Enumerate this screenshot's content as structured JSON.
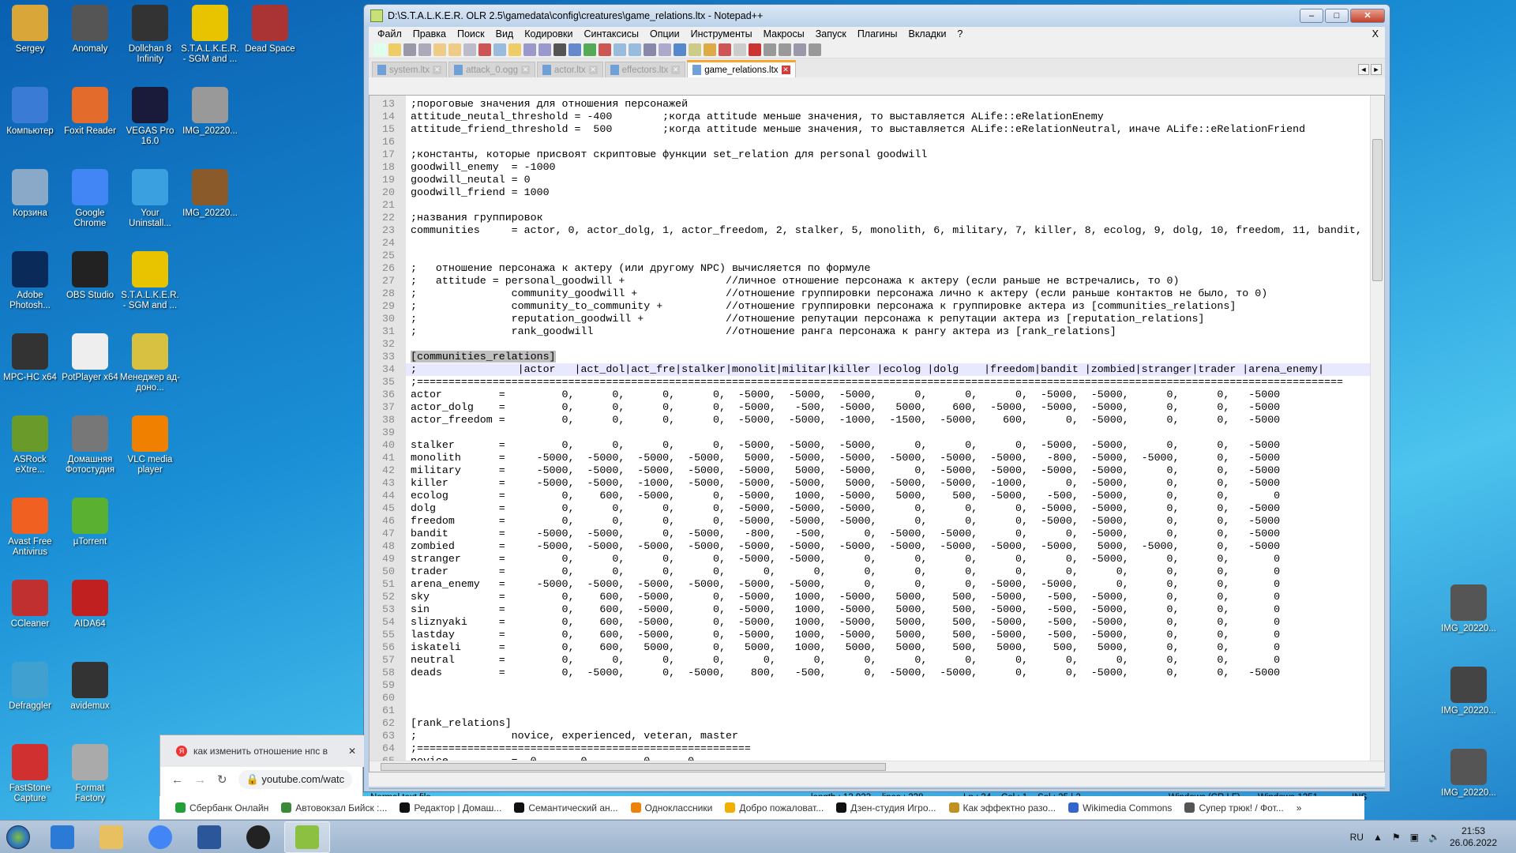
{
  "desktop": {
    "icons": [
      {
        "label": "Sergey",
        "color": "#d9a63a"
      },
      {
        "label": "Anomaly",
        "color": "#555"
      },
      {
        "label": "Dollchan 8 Infinity",
        "color": "#333"
      },
      {
        "label": "S.T.A.L.K.E.R. - SGM and ...",
        "color": "#e8c400"
      },
      {
        "label": "Dead Space",
        "color": "#a33"
      },
      {
        "label": "Компьютер",
        "color": "#3a7bd5"
      },
      {
        "label": "Foxit Reader",
        "color": "#e36b2c"
      },
      {
        "label": "VEGAS Pro 16.0",
        "color": "#1a1a3a"
      },
      {
        "label": "IMG_20220...",
        "color": "#999"
      },
      {
        "label": "Корзина",
        "color": "#8aa8c8"
      },
      {
        "label": "Google Chrome",
        "color": "#4285f4"
      },
      {
        "label": "Your Uninstall...",
        "color": "#3aa0e0"
      },
      {
        "label": "IMG_20220...",
        "color": "#8a5a2a"
      },
      {
        "label": "Adobe Photosh...",
        "color": "#0a2a5a"
      },
      {
        "label": "OBS Studio",
        "color": "#222"
      },
      {
        "label": "S.T.A.L.K.E.R. - SGM and ...",
        "color": "#e8c400"
      },
      {
        "label": "MPC-HC x64",
        "color": "#333"
      },
      {
        "label": "PotPlayer x64",
        "color": "#eee"
      },
      {
        "label": "Менеджер ад-доно...",
        "color": "#d8c040"
      },
      {
        "label": "ASRock eXtre...",
        "color": "#6a9a2a"
      },
      {
        "label": "Домашняя Фотостудия",
        "color": "#777"
      },
      {
        "label": "VLC media player",
        "color": "#f08000"
      },
      {
        "label": "Avast Free Antivirus",
        "color": "#f06020"
      },
      {
        "label": "µTorrent",
        "color": "#5ab030"
      },
      {
        "label": "CCleaner",
        "color": "#c03030"
      },
      {
        "label": "AIDA64",
        "color": "#c02020"
      },
      {
        "label": "Defraggler",
        "color": "#40a0d0"
      },
      {
        "label": "avidemux",
        "color": "#333"
      },
      {
        "label": "FastStone Capture",
        "color": "#d03030"
      },
      {
        "label": "Format Factory",
        "color": "#aaa"
      }
    ],
    "right_icons": [
      {
        "label": "IMG_20220...",
        "color": "#555"
      },
      {
        "label": "IMG_20220...",
        "color": "#444"
      },
      {
        "label": "IMG_20220...",
        "color": "#555"
      }
    ]
  },
  "notepad": {
    "title": "D:\\S.T.A.L.K.E.R. OLR 2.5\\gamedata\\config\\creatures\\game_relations.ltx - Notepad++",
    "menu": [
      "Файл",
      "Правка",
      "Поиск",
      "Вид",
      "Кодировки",
      "Синтаксисы",
      "Опции",
      "Инструменты",
      "Макросы",
      "Запуск",
      "Плагины",
      "Вкладки",
      "?"
    ],
    "menu_close": "X",
    "tabs": [
      {
        "label": "system.ltx",
        "active": false
      },
      {
        "label": "attack_0.ogg",
        "active": false
      },
      {
        "label": "actor.ltx",
        "active": false
      },
      {
        "label": "effectors.ltx",
        "active": false
      },
      {
        "label": "game_relations.ltx",
        "active": true
      }
    ],
    "current_line": 34,
    "lines": [
      {
        "n": 13,
        "t": ";пороговые значения для отношения персонажей"
      },
      {
        "n": 14,
        "t": "attitude_neutal_threshold = -400        ;когда attitude меньше значения, то выставляется ALife::eRelationEnemy"
      },
      {
        "n": 15,
        "t": "attitude_friend_threshold =  500        ;когда attitude меньше значения, то выставляется ALife::eRelationNeutral, иначе ALife::eRelationFriend"
      },
      {
        "n": 16,
        "t": ""
      },
      {
        "n": 17,
        "t": ";константы, которые присвоят скриптовые функции set_relation для personal goodwill"
      },
      {
        "n": 18,
        "t": "goodwill_enemy  = -1000"
      },
      {
        "n": 19,
        "t": "goodwill_neutal = 0"
      },
      {
        "n": 20,
        "t": "goodwill_friend = 1000"
      },
      {
        "n": 21,
        "t": ""
      },
      {
        "n": 22,
        "t": ";названия группировок"
      },
      {
        "n": 23,
        "t": "communities     = actor, 0, actor_dolg, 1, actor_freedom, 2, stalker, 5, monolith, 6, military, 7, killer, 8, ecolog, 9, dolg, 10, freedom, 11, bandit,"
      },
      {
        "n": 24,
        "t": ""
      },
      {
        "n": 25,
        "t": ""
      },
      {
        "n": 26,
        "t": ";   отношение персонажа к актеру (или другому NPC) вычисляется по формуле"
      },
      {
        "n": 27,
        "t": ";   attitude = personal_goodwill +                //личное отношение персонажа к актеру (если раньше не встречались, то 0)"
      },
      {
        "n": 28,
        "t": ";               community_goodwill +              //отношение группировки персонажа лично к актеру (если раньше контактов не было, то 0)"
      },
      {
        "n": 29,
        "t": ";               community_to_community +          //отношение группировки персонажа к группировке актера из [communities_relations]"
      },
      {
        "n": 30,
        "t": ";               reputation_goodwill +             //отношение репутации персонажа к репутации актера из [reputation_relations]"
      },
      {
        "n": 31,
        "t": ";               rank_goodwill                     //отношение ранга персонажа к рангу актера из [rank_relations]"
      },
      {
        "n": 32,
        "t": ""
      },
      {
        "n": 33,
        "t": "[communities_relations]",
        "sel": true
      },
      {
        "n": 34,
        "t": ";                |actor   |act_dol|act_fre|stalker|monolit|militar|killer |ecolog |dolg    |freedom|bandit |zombied|stranger|trader |arena_enemy|"
      },
      {
        "n": 35,
        "t": ";==================================================================================================================================================="
      },
      {
        "n": 36,
        "row": "actor",
        "v": [
          0,
          0,
          0,
          0,
          -5000,
          -5000,
          -5000,
          0,
          0,
          0,
          -5000,
          -5000,
          0,
          0,
          -5000
        ]
      },
      {
        "n": 37,
        "row": "actor_dolg",
        "v": [
          0,
          0,
          0,
          0,
          -5000,
          -500,
          -5000,
          5000,
          600,
          -5000,
          -5000,
          -5000,
          0,
          0,
          -5000
        ]
      },
      {
        "n": 38,
        "row": "actor_freedom",
        "v": [
          0,
          0,
          0,
          0,
          -5000,
          -5000,
          -1000,
          -1500,
          -5000,
          600,
          0,
          -5000,
          0,
          0,
          -5000
        ]
      },
      {
        "n": 39,
        "t": ""
      },
      {
        "n": 40,
        "row": "stalker",
        "v": [
          0,
          0,
          0,
          0,
          -5000,
          -5000,
          -5000,
          0,
          0,
          0,
          -5000,
          -5000,
          0,
          0,
          -5000
        ]
      },
      {
        "n": 41,
        "row": "monolith",
        "v": [
          -5000,
          -5000,
          -5000,
          -5000,
          5000,
          -5000,
          -5000,
          -5000,
          -5000,
          -5000,
          -800,
          -5000,
          -5000,
          0,
          -5000
        ]
      },
      {
        "n": 42,
        "row": "military",
        "v": [
          -5000,
          -5000,
          -5000,
          -5000,
          -5000,
          5000,
          -5000,
          0,
          -5000,
          -5000,
          -5000,
          -5000,
          0,
          0,
          -5000
        ]
      },
      {
        "n": 43,
        "row": "killer",
        "v": [
          -5000,
          -5000,
          -1000,
          -5000,
          -5000,
          -5000,
          5000,
          -5000,
          -5000,
          -1000,
          0,
          -5000,
          0,
          0,
          -5000
        ]
      },
      {
        "n": 44,
        "row": "ecolog",
        "v": [
          0,
          600,
          -5000,
          0,
          -5000,
          1000,
          -5000,
          5000,
          500,
          -5000,
          -500,
          -5000,
          0,
          0,
          0
        ]
      },
      {
        "n": 45,
        "row": "dolg",
        "v": [
          0,
          0,
          0,
          0,
          -5000,
          -5000,
          -5000,
          0,
          0,
          0,
          -5000,
          -5000,
          0,
          0,
          -5000
        ]
      },
      {
        "n": 46,
        "row": "freedom",
        "v": [
          0,
          0,
          0,
          0,
          -5000,
          -5000,
          -5000,
          0,
          0,
          0,
          -5000,
          -5000,
          0,
          0,
          -5000
        ]
      },
      {
        "n": 47,
        "row": "bandit",
        "v": [
          -5000,
          -5000,
          0,
          -5000,
          -800,
          -500,
          0,
          -5000,
          -5000,
          0,
          0,
          -5000,
          0,
          0,
          -5000
        ]
      },
      {
        "n": 48,
        "row": "zombied",
        "v": [
          -5000,
          -5000,
          -5000,
          -5000,
          -5000,
          -5000,
          -5000,
          -5000,
          -5000,
          -5000,
          -5000,
          5000,
          -5000,
          0,
          -5000
        ]
      },
      {
        "n": 49,
        "row": "stranger",
        "v": [
          0,
          0,
          0,
          0,
          -5000,
          -5000,
          0,
          0,
          0,
          0,
          0,
          -5000,
          0,
          0,
          0
        ]
      },
      {
        "n": 50,
        "row": "trader",
        "v": [
          0,
          0,
          0,
          0,
          0,
          0,
          0,
          0,
          0,
          0,
          0,
          0,
          0,
          0,
          0
        ]
      },
      {
        "n": 51,
        "row": "arena_enemy",
        "v": [
          -5000,
          -5000,
          -5000,
          -5000,
          -5000,
          -5000,
          0,
          0,
          0,
          -5000,
          -5000,
          0,
          0,
          0,
          0
        ]
      },
      {
        "n": 52,
        "row": "sky",
        "v": [
          0,
          600,
          -5000,
          0,
          -5000,
          1000,
          -5000,
          5000,
          500,
          -5000,
          -500,
          -5000,
          0,
          0,
          0
        ]
      },
      {
        "n": 53,
        "row": "sin",
        "v": [
          0,
          600,
          -5000,
          0,
          -5000,
          1000,
          -5000,
          5000,
          500,
          -5000,
          -500,
          -5000,
          0,
          0,
          0
        ]
      },
      {
        "n": 54,
        "row": "sliznyaki",
        "v": [
          0,
          600,
          -5000,
          0,
          -5000,
          1000,
          -5000,
          5000,
          500,
          -5000,
          -500,
          -5000,
          0,
          0,
          0
        ]
      },
      {
        "n": 55,
        "row": "lastday",
        "v": [
          0,
          600,
          -5000,
          0,
          -5000,
          1000,
          -5000,
          5000,
          500,
          -5000,
          -500,
          -5000,
          0,
          0,
          0
        ]
      },
      {
        "n": 56,
        "row": "iskateli",
        "v": [
          0,
          600,
          5000,
          0,
          5000,
          1000,
          5000,
          5000,
          500,
          5000,
          500,
          5000,
          0,
          0,
          0
        ]
      },
      {
        "n": 57,
        "row": "neutral",
        "v": [
          0,
          0,
          0,
          0,
          0,
          0,
          0,
          0,
          0,
          0,
          0,
          0,
          0,
          0,
          0
        ]
      },
      {
        "n": 58,
        "row": "deads",
        "v": [
          0,
          -5000,
          0,
          -5000,
          800,
          -500,
          0,
          -5000,
          -5000,
          0,
          0,
          -5000,
          0,
          0,
          -5000
        ]
      },
      {
        "n": 59,
        "t": ""
      },
      {
        "n": 60,
        "t": ""
      },
      {
        "n": 61,
        "t": ""
      },
      {
        "n": 62,
        "t": "[rank_relations]"
      },
      {
        "n": 63,
        "t": ";               novice, experienced, veteran, master"
      },
      {
        "n": 64,
        "t": ";====================================================="
      },
      {
        "n": 65,
        "t": "novice          =  0,      0,        0,     0"
      }
    ],
    "status": {
      "type": "Normal text file",
      "length": "length : 13 923",
      "lines": "lines : 238",
      "pos": "Ln : 34    Col : 1    Sel : 25 | 2",
      "eol": "Windows (CR LF)",
      "encoding": "Windows-1251",
      "mode": "INS"
    }
  },
  "chrome": {
    "tab_title": "как изменить отношение нпс в",
    "url": "youtube.com/watc",
    "bookmarks": [
      {
        "label": "Сбербанк Онлайн",
        "color": "#21a038"
      },
      {
        "label": "Автовокзал Бийск :...",
        "color": "#3a8a3a"
      },
      {
        "label": "Редактор | Домаш...",
        "color": "#111"
      },
      {
        "label": "Семантический ан...",
        "color": "#111"
      },
      {
        "label": "Одноклассники",
        "color": "#ee8208"
      },
      {
        "label": "Добро пожаловат...",
        "color": "#f0b000"
      },
      {
        "label": "Дзен-студия Игро...",
        "color": "#111"
      },
      {
        "label": "Как эффектно разо...",
        "color": "#c09020"
      },
      {
        "label": "Wikimedia Commons",
        "color": "#3366cc"
      },
      {
        "label": "Супер трюк! / Фот...",
        "color": "#555"
      }
    ],
    "more": "»"
  },
  "taskbar": {
    "apps": [
      {
        "name": "ie",
        "color": "#2a7ad6"
      },
      {
        "name": "explorer",
        "color": "#e8c060"
      },
      {
        "name": "chrome",
        "color": "#4285f4"
      },
      {
        "name": "word",
        "color": "#2b579a"
      },
      {
        "name": "obs",
        "color": "#222"
      },
      {
        "name": "notepad-plus-plus",
        "color": "#8cc040",
        "active": true
      }
    ],
    "lang": "RU",
    "time": "21:53",
    "date": "26.06.2022"
  }
}
